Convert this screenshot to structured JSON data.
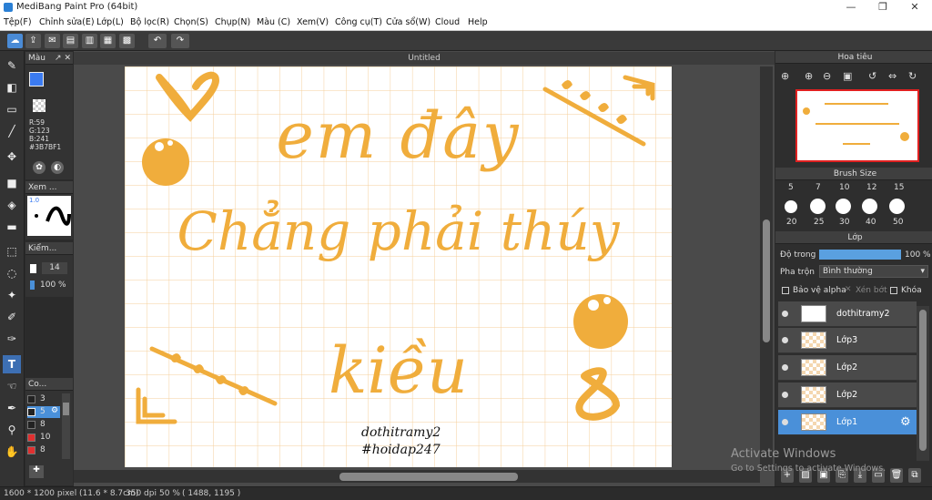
{
  "window": {
    "title": "MediBang Paint Pro (64bit)",
    "minimize": "—",
    "maximize": "❐",
    "close": "✕"
  },
  "menu": [
    "Tệp(F)",
    "Chỉnh sửa(E)",
    "Lớp(L)",
    "Bộ lọc(R)",
    "Chọn(S)",
    "Chụp(N)",
    "Màu (C)",
    "Xem(V)",
    "Công cụ(T)",
    "Cửa sổ(W)",
    "Cloud",
    "Help"
  ],
  "color_panel": {
    "title": "Màu",
    "r": "R:59",
    "g": "G:123",
    "b": "B:241",
    "hex": "#3B7BF1",
    "fg": "#3b7bf1"
  },
  "preview_panel": {
    "title": "Xem ...",
    "brush_size": "1.0"
  },
  "brush_panel_small": {
    "title": "Kiểm...",
    "size": "14",
    "opacity": "100 %"
  },
  "color_list": {
    "title": "Co...",
    "items": [
      {
        "label": "3",
        "color": "#222"
      },
      {
        "label": "5",
        "color": "#222"
      },
      {
        "label": "8",
        "color": "#222"
      },
      {
        "label": "10",
        "color": "#e03030"
      },
      {
        "label": "8",
        "color": "#e03030"
      }
    ]
  },
  "document": {
    "tab": "Untitled"
  },
  "canvas_text": {
    "line1": "em đây",
    "line2": "Chẳng phải thúy",
    "line3": "kiều",
    "sign1": "dothitramy2",
    "sign2": "#hoidap247"
  },
  "navigator": {
    "title": "Hoa tiêu"
  },
  "brush_size": {
    "title": "Brush Size",
    "row1": [
      "5",
      "7",
      "10",
      "12",
      "15"
    ],
    "row2": [
      "20",
      "25",
      "30",
      "40",
      "50"
    ]
  },
  "layer_panel": {
    "title": "Lớp",
    "opacity_label": "Độ trong",
    "opacity_value": "100 %",
    "opacity_fraction": 1.0,
    "blend_label": "Pha trộn",
    "blend_value": "Bình thường",
    "protect_alpha": "Bảo vệ alpha",
    "clipping": "Xén bớt",
    "lock": "Khóa",
    "layers": [
      {
        "name": "dothitramy2"
      },
      {
        "name": "Lớp3"
      },
      {
        "name": "Lớp2"
      },
      {
        "name": "Lớp2"
      },
      {
        "name": "Lớp1",
        "selected": true
      }
    ]
  },
  "status": {
    "size": "1600 * 1200 pixel   (11.6 * 8.7cm)",
    "dpi": "350 dpi",
    "zoom": "50 %",
    "coords": "( 1488, 1195 )"
  },
  "watermark": {
    "line1": "Activate Windows",
    "line2": "Go to Settings to activate Windows."
  },
  "colors": {
    "accent": "#f0ad3c",
    "selected_layer": "#4a90d9"
  }
}
